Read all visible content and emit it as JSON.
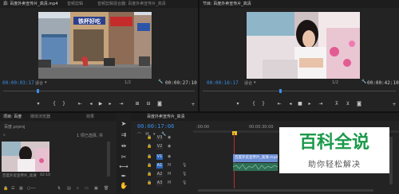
{
  "source_monitor": {
    "tabs": [
      "源: 百度外卖宣传片_高清.mp4",
      "音频剪辑",
      "音频剪辑混合器: 百度外卖宣传片_高清"
    ],
    "timecode_current": "00:00:03:17",
    "fit_label": "适合",
    "ratio_label": "1/2",
    "timecode_duration": "00:00:27:10"
  },
  "program_monitor": {
    "tab": "节目: 百度外卖宣传片_高清",
    "timecode_current": "00:00:16:17",
    "fit_label": "适合",
    "ratio_label": "1/2",
    "timecode_duration": "00:00:42:10"
  },
  "project_panel": {
    "tabs": [
      "项目: 百度",
      "媒体浏览器",
      "效果"
    ],
    "file_label": "百度.prproj",
    "status": "1 项已选择, 共",
    "clip_name": "百度外卖宣传片_高清",
    "clip_duration": "42:10"
  },
  "timeline": {
    "tab": "百度外卖宣传片_高清",
    "timecode": "00:00:17:06",
    "ruler_start": ":00:00",
    "ruler_mid": "00:00:30:00",
    "tracks": [
      "V3",
      "V2",
      "V1",
      "A1",
      "A2",
      "A3"
    ],
    "video_clip": "百度外卖宣传片_高清.mp4 [V]"
  },
  "storefront_sign": "铁杯好吃",
  "watermark": {
    "title": "百科全说",
    "subtitle": "助你轻松解决"
  },
  "colors": {
    "accent": "#3a8ee6",
    "watermark_green": "#1a9a4a",
    "video_clip": "#6d8fd6",
    "audio_clip": "#2f6f55"
  }
}
